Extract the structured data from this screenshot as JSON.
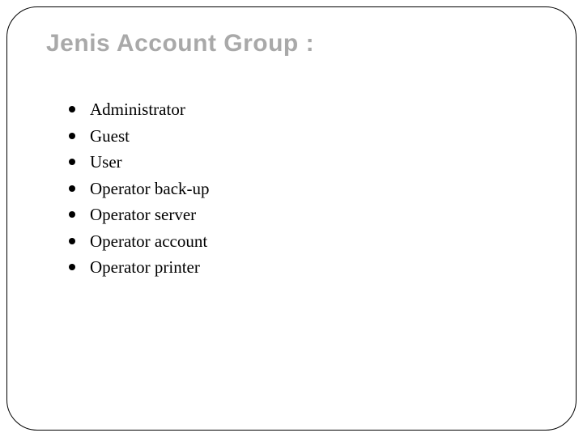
{
  "title": "Jenis Account Group :",
  "items": [
    "Administrator",
    "Guest",
    "User",
    "Operator back-up",
    "Operator server",
    "Operator account",
    "Operator printer"
  ]
}
